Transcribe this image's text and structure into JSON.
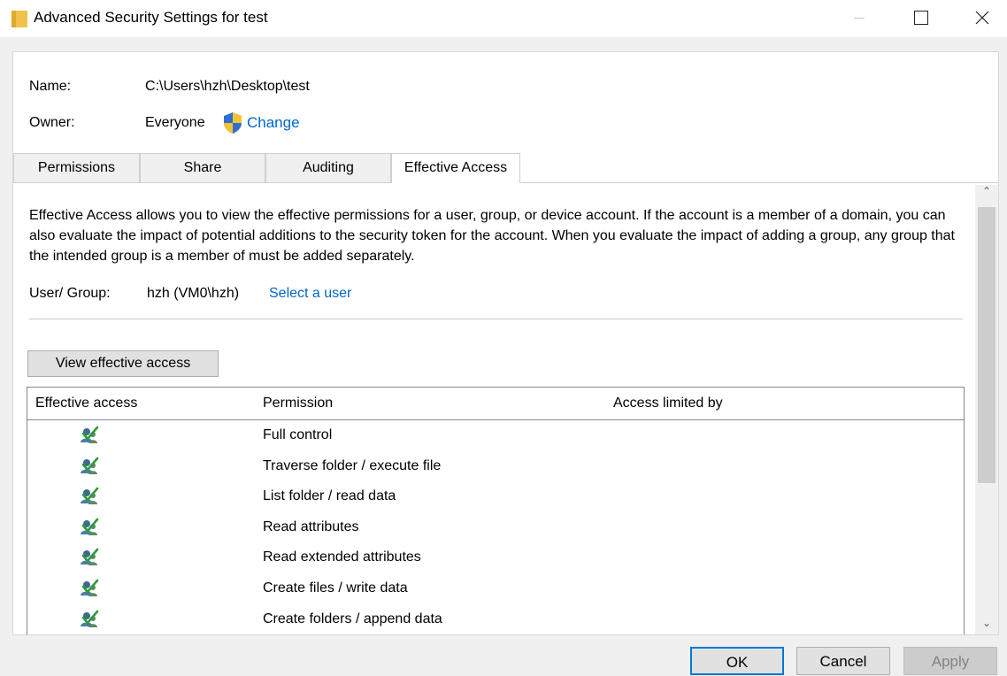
{
  "window": {
    "title": "Advanced Security Settings for test",
    "folder_color": "#f0c24a"
  },
  "info": {
    "name_label": "Name:",
    "name_value": "C:\\Users\\hzh\\Desktop\\test",
    "owner_label": "Owner:",
    "owner_value": "Everyone",
    "change_link": "Change"
  },
  "tabs": [
    {
      "label": "Permissions"
    },
    {
      "label": "Share"
    },
    {
      "label": "Auditing"
    },
    {
      "label": "Effective Access",
      "selected": true
    }
  ],
  "effective_access": {
    "description": "Effective Access allows you to view the effective permissions for a user, group, or device account. If the account is a member of a domain, you can also evaluate the impact of potential additions to the security token for the account. When you evaluate the impact of adding a group, any group that the intended group is a member of must be added separately.",
    "user_label": "User/ Group:",
    "user_value": "hzh (VM0\\hzh)",
    "select_user_link": "Select a user",
    "view_button": "View effective access"
  },
  "grid": {
    "columns": [
      "Effective access",
      "Permission",
      "Access limited by"
    ],
    "rows": [
      {
        "permission": "Full control",
        "icon": "user-check-icon"
      },
      {
        "permission": "Traverse folder / execute file",
        "icon": "user-check-icon"
      },
      {
        "permission": "List folder / read data",
        "icon": "user-check-icon"
      },
      {
        "permission": "Read attributes",
        "icon": "user-check-icon"
      },
      {
        "permission": "Read extended attributes",
        "icon": "user-check-icon"
      },
      {
        "permission": "Create files / write data",
        "icon": "user-check-icon"
      },
      {
        "permission": "Create folders / append data",
        "icon": "user-check-icon"
      }
    ]
  },
  "buttons": {
    "ok": "OK",
    "cancel": "Cancel",
    "apply": "Apply"
  },
  "colors": {
    "link": "#0066cc",
    "accent": "#0078d7"
  }
}
